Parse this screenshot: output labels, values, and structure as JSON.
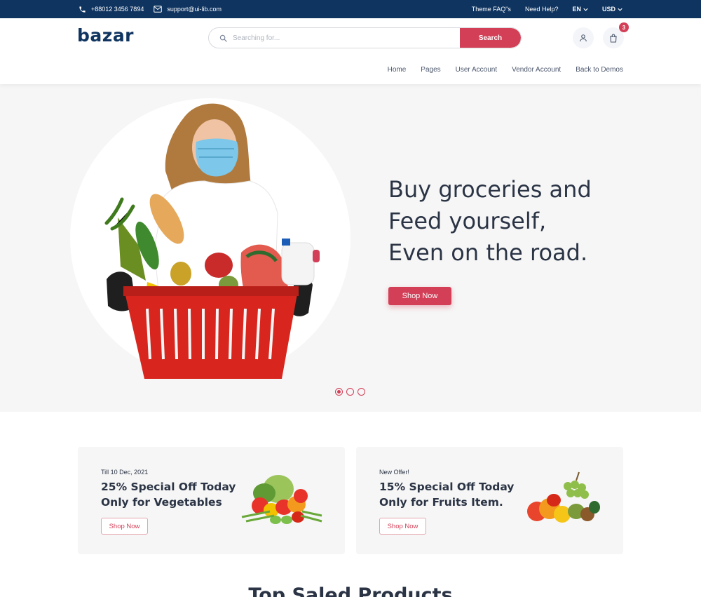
{
  "topbar": {
    "phone": "+88012 3456 7894",
    "email": "support@ui-lib.com",
    "links": [
      "Theme FAQ\"s",
      "Need Help?"
    ],
    "language": "EN",
    "currency": "USD"
  },
  "header": {
    "logo": "bazar",
    "search_placeholder": "Searching for...",
    "search_button": "Search",
    "cart_count": "3",
    "nav": [
      "Home",
      "Pages",
      "User Account",
      "Vendor Account",
      "Back to Demos"
    ]
  },
  "hero": {
    "heading_lines": [
      "Buy groceries and",
      "Feed yourself,",
      "Even on the road."
    ],
    "cta": "Shop Now",
    "slides_total": 3,
    "active_slide": 1
  },
  "offers": [
    {
      "tag": "Till 10 Dec, 2021",
      "title_lines": [
        "25% Special Off Today",
        "Only for Vegetables"
      ],
      "button": "Shop Now"
    },
    {
      "tag": "New Offer!",
      "title_lines": [
        "15% Special Off Today",
        "Only for Fruits Item."
      ],
      "button": "Shop Now"
    }
  ],
  "section_title": "Top Saled Products",
  "colors": {
    "primary": "#d23f57",
    "navy": "#0f3460",
    "text": "#2b3445",
    "surface": "#f6f6f6"
  },
  "icons": [
    "phone-icon",
    "mail-icon",
    "chevron-down-icon",
    "search-icon",
    "user-icon",
    "shopping-bag-icon"
  ]
}
